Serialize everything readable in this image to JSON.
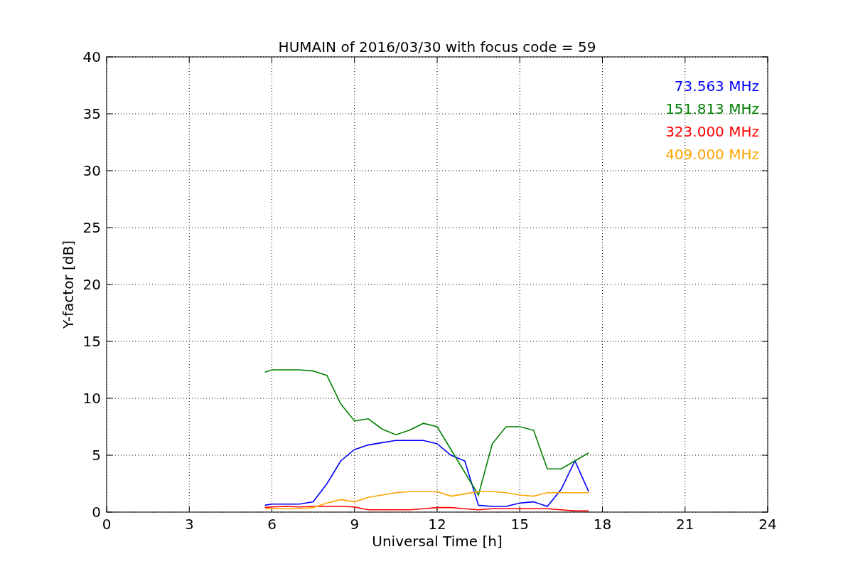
{
  "chart_data": {
    "type": "line",
    "title": "HUMAIN of 2016/03/30 with focus code = 59",
    "xlabel": "Universal Time [h]",
    "ylabel": "Y-factor [dB]",
    "x": [
      5.75,
      6,
      6.5,
      7,
      7.5,
      8,
      8.5,
      9,
      9.5,
      10,
      10.5,
      11,
      11.5,
      12,
      12.5,
      13,
      13.5,
      14,
      14.5,
      15,
      15.5,
      16,
      16.5,
      17,
      17.5
    ],
    "series": [
      {
        "name": "73.563 MHz",
        "color": "#0000ff",
        "values": [
          0.6,
          0.7,
          0.7,
          0.7,
          0.9,
          2.5,
          4.5,
          5.5,
          5.9,
          6.1,
          6.3,
          6.3,
          6.3,
          6.0,
          5.0,
          4.5,
          0.6,
          0.5,
          0.5,
          0.8,
          0.9,
          0.5,
          2.0,
          4.5,
          1.8
        ]
      },
      {
        "name": "151.813 MHz",
        "color": "#008000",
        "values": [
          12.3,
          12.5,
          12.5,
          12.5,
          12.4,
          12.0,
          9.5,
          8.0,
          8.2,
          7.3,
          6.8,
          7.2,
          7.8,
          7.5,
          5.5,
          3.5,
          1.5,
          6.0,
          7.5,
          7.5,
          7.2,
          3.8,
          3.8,
          4.5,
          5.2
        ]
      },
      {
        "name": "323.000 MHz",
        "color": "#ff0000",
        "values": [
          0.4,
          0.45,
          0.5,
          0.45,
          0.5,
          0.5,
          0.5,
          0.45,
          0.2,
          0.2,
          0.2,
          0.2,
          0.3,
          0.4,
          0.4,
          0.3,
          0.2,
          0.3,
          0.3,
          0.3,
          0.3,
          0.3,
          0.2,
          0.1,
          0.1
        ]
      },
      {
        "name": "409.000 MHz",
        "color": "#ffa500",
        "values": [
          0.3,
          0.3,
          0.3,
          0.3,
          0.4,
          0.8,
          1.1,
          0.9,
          1.3,
          1.5,
          1.7,
          1.8,
          1.8,
          1.8,
          1.4,
          1.6,
          1.8,
          1.8,
          1.7,
          1.5,
          1.4,
          1.7,
          1.7,
          1.7,
          1.7
        ]
      }
    ],
    "xlim": [
      0,
      24
    ],
    "ylim": [
      0,
      40
    ],
    "xticks": [
      0,
      3,
      6,
      9,
      12,
      15,
      18,
      21,
      24
    ],
    "yticks": [
      0,
      5,
      10,
      15,
      20,
      25,
      30,
      35,
      40
    ],
    "grid": true
  }
}
